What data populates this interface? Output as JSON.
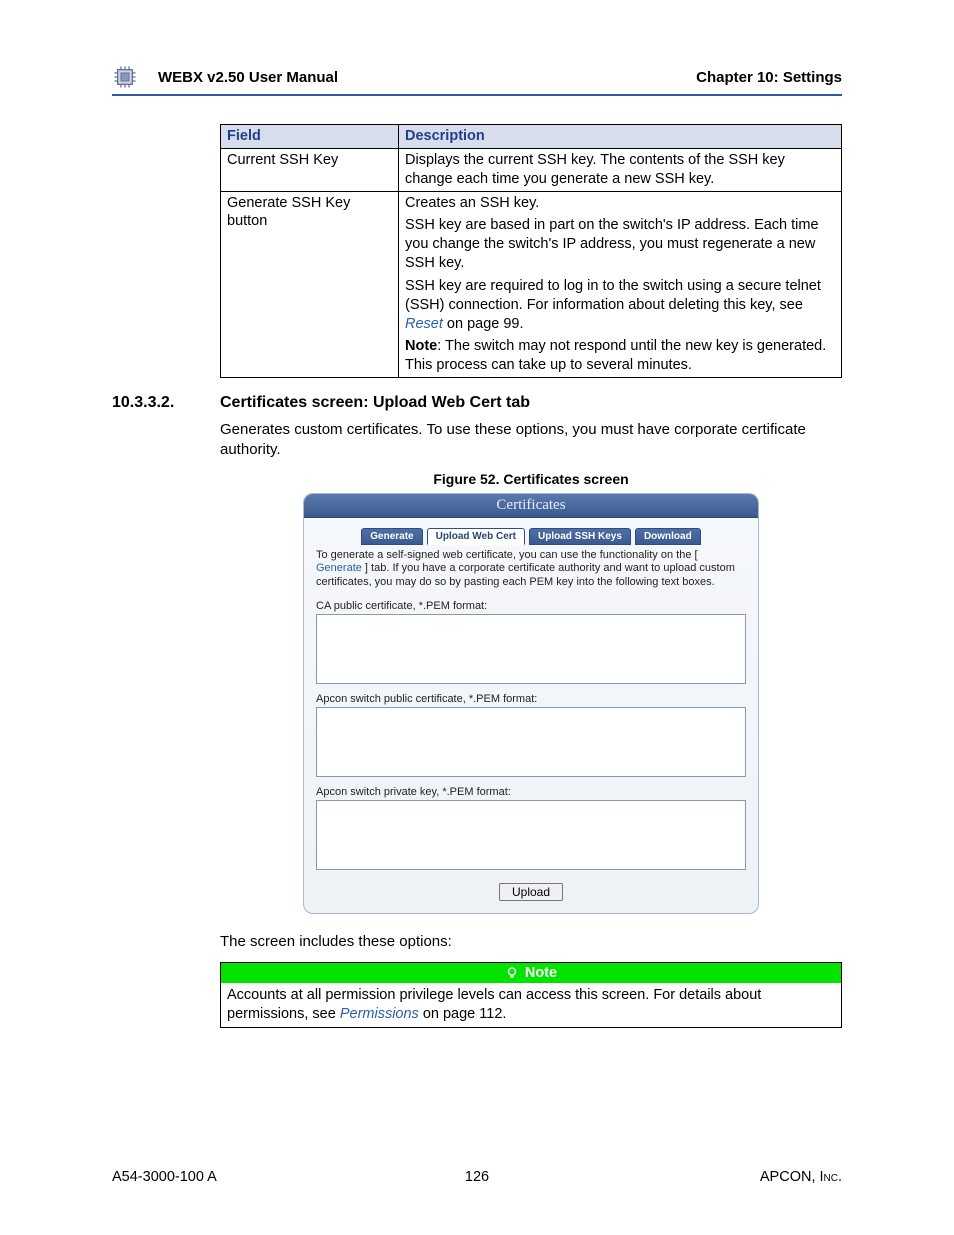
{
  "header": {
    "manual": "WEBX v2.50 User Manual",
    "chapter": "Chapter 10: Settings"
  },
  "table": {
    "col_field": "Field",
    "col_desc": "Description",
    "rows": [
      {
        "field": "Current SSH Key",
        "desc_p1": "Displays the current SSH key. The contents of the SSH key change each time you generate a new SSH key."
      },
      {
        "field": "Generate SSH Key button",
        "desc_p1": "Creates an SSH key.",
        "desc_p2": "SSH key are based in part on the switch's IP address. Each time you change the switch's IP address, you must regenerate a new SSH key.",
        "desc_p3a": "SSH key are required to log in to the switch using a secure telnet (SSH) connection. For information about deleting this key, see ",
        "desc_p3_link": "Reset",
        "desc_p3b": " on page 99.",
        "desc_p4a": "Note",
        "desc_p4b": ": The switch may not respond until the new key is generated. This process can take up to several minutes."
      }
    ]
  },
  "section": {
    "num": "10.3.3.2.",
    "title": "Certificates screen: Upload Web Cert tab",
    "intro": "Generates custom certificates. To use these options, you must have corporate certificate authority.",
    "figcap": "Figure 52. Certificates screen",
    "options_intro": "The screen includes these options:"
  },
  "cert": {
    "title": "Certificates",
    "tabs": {
      "generate": "Generate",
      "upload_web": "Upload Web Cert",
      "upload_ssh": "Upload SSH Keys",
      "download": "Download"
    },
    "instr_a": "To generate a self-signed web certificate, you can use the functionality on the [ ",
    "instr_link": "Generate",
    "instr_b": " ] tab. If you have a corporate certificate authority and want to upload custom certificates, you may do so by pasting each PEM key into the following text boxes.",
    "label_ca": "CA public certificate, *.PEM format:",
    "label_pub": "Apcon switch public certificate, *.PEM format:",
    "label_priv": "Apcon switch private key, *.PEM format:",
    "upload": "Upload"
  },
  "note": {
    "label": "Note",
    "body_a": "Accounts at all permission privilege levels can access this screen. For details about permissions, see ",
    "link": "Permissions",
    "body_b": " on page 112."
  },
  "footer": {
    "left": "A54-3000-100 A",
    "center": "126",
    "right": "APCON, Inc."
  }
}
